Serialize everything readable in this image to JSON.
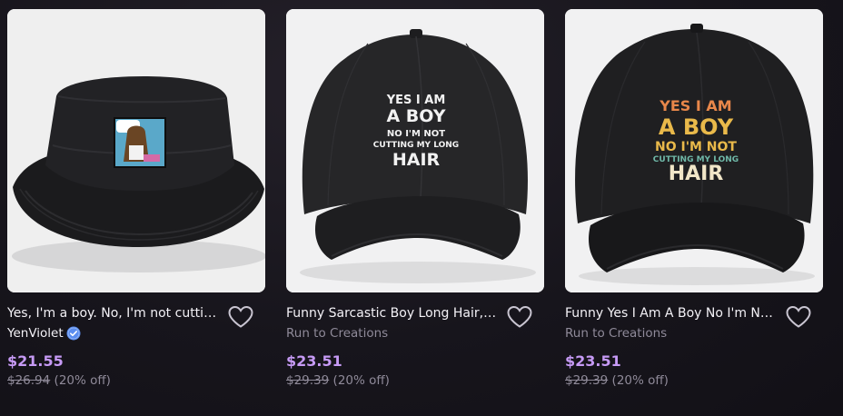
{
  "products": [
    {
      "title": "Yes, I'm a boy. No, I'm not cutting my long hair",
      "artist": "YenViolet",
      "artist_verified": true,
      "price": "$21.55",
      "old_price": "$26.94",
      "discount": "(20% off)",
      "image_icon": "bucket-hat-icon"
    },
    {
      "title": "Funny Sarcastic Boy Long Hair, Yes I Am A Boy",
      "artist": "Run to Creations",
      "artist_verified": false,
      "price": "$23.51",
      "old_price": "$29.39",
      "discount": "(20% off)",
      "image_icon": "dad-hat-icon",
      "cap_text": [
        "YES I AM",
        "A BOY",
        "NO I'M NOT",
        "CUTTING MY LONG",
        "HAIR"
      ]
    },
    {
      "title": "Funny Yes I Am A Boy No I'm Not Cutting My Long Hair",
      "artist": "Run to Creations",
      "artist_verified": false,
      "price": "$23.51",
      "old_price": "$29.39",
      "discount": "(20% off)",
      "image_icon": "dad-hat-icon",
      "cap_text": [
        "YES I AM",
        "A BOY",
        "NO I'M NOT",
        "CUTTING MY LONG",
        "HAIR"
      ]
    }
  ],
  "colors": {
    "background": "#17151c",
    "price": "#c69af5",
    "muted": "#8f8a99",
    "text": "#f4f2f7",
    "verified": "#5b8def",
    "cap_text_orange": "#e8874a",
    "cap_text_yellow": "#e9b94a",
    "cap_text_teal": "#6fb8a8",
    "cap_text_cream": "#f1e6c8"
  },
  "icons": {
    "favorite": "heart-outline-icon",
    "verified": "verified-badge-icon"
  }
}
